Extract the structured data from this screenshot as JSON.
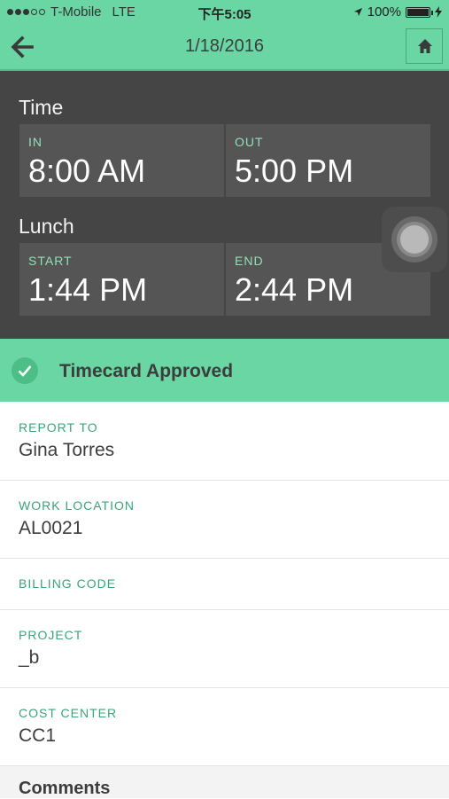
{
  "status_bar": {
    "carrier": "T-Mobile",
    "network": "LTE",
    "time": "下午5:05",
    "battery": "100%",
    "battery_level": 1.0
  },
  "nav": {
    "title": "1/18/2016",
    "back_icon": "arrow-left-icon",
    "home_icon": "home-icon"
  },
  "time": {
    "heading": "Time",
    "in_label": "IN",
    "in_value": "8:00 AM",
    "out_label": "OUT",
    "out_value": "5:00 PM"
  },
  "lunch": {
    "heading": "Lunch",
    "start_label": "START",
    "start_value": "1:44 PM",
    "end_label": "END",
    "end_value": "2:44 PM"
  },
  "approval": {
    "text": "Timecard Approved",
    "icon": "check-circle-icon"
  },
  "fields": {
    "report_to_label": "REPORT TO",
    "report_to_value": "Gina Torres",
    "work_location_label": "WORK LOCATION",
    "work_location_value": "AL0021",
    "billing_code_label": "BILLING CODE",
    "project_label": "PROJECT",
    "project_value": "_b",
    "cost_center_label": "COST CENTER",
    "cost_center_value": "CC1"
  },
  "comments": {
    "title": "Comments"
  },
  "colors": {
    "accent": "#6ad6a4",
    "panel": "#454545",
    "label_green": "#3aa57a"
  }
}
